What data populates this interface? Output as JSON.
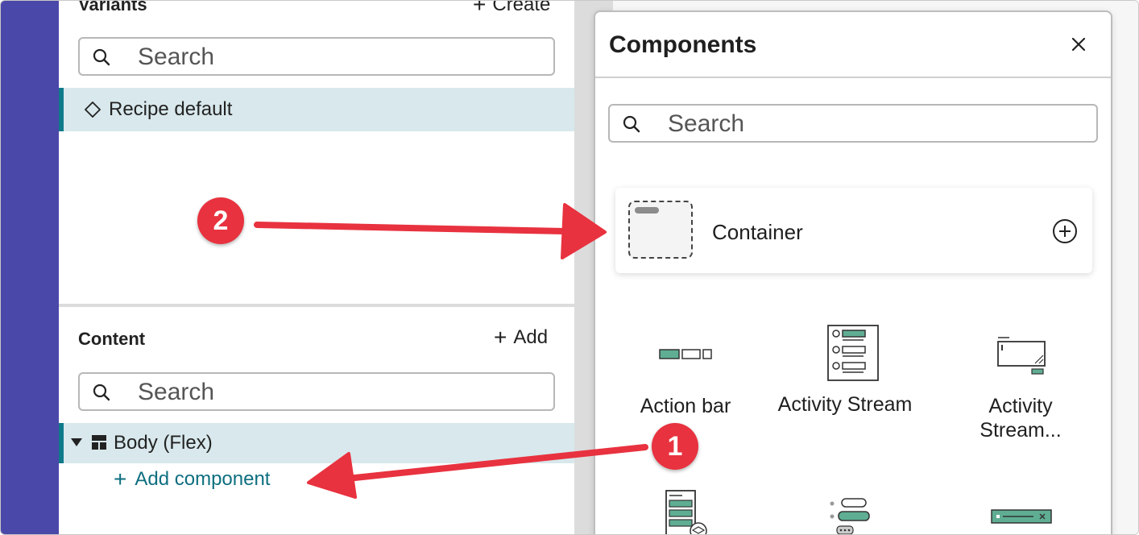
{
  "variants": {
    "heading": "Variants",
    "create_label": "Create",
    "search_placeholder": "Search",
    "items": [
      {
        "label": "Recipe default"
      }
    ]
  },
  "content": {
    "heading": "Content",
    "add_label": "Add",
    "search_placeholder": "Search",
    "tree": [
      {
        "label": "Body (Flex)",
        "expanded": true
      }
    ],
    "add_component_label": "Add component"
  },
  "components_panel": {
    "title": "Components",
    "search_placeholder": "Search",
    "featured": {
      "label": "Container"
    },
    "tiles": [
      {
        "label": "Action bar",
        "icon": "action-bar-icon"
      },
      {
        "label": "Activity Stream",
        "icon": "activity-stream-icon"
      },
      {
        "label": "Activity Stream...",
        "icon": "activity-stream-composer-icon"
      },
      {
        "label": "",
        "icon": "list-scholar-icon"
      },
      {
        "label": "",
        "icon": "chat-icon"
      },
      {
        "label": "",
        "icon": "alert-banner-icon"
      }
    ]
  },
  "annotations": [
    {
      "number": "1"
    },
    {
      "number": "2"
    }
  ],
  "colors": {
    "left_rail": "#4a48a8",
    "selected_row": "#d8e8ec",
    "selected_accent": "#0f7a8a",
    "link": "#0e6f80",
    "annotation": "#e8323f",
    "icon_green": "#5fae94"
  }
}
